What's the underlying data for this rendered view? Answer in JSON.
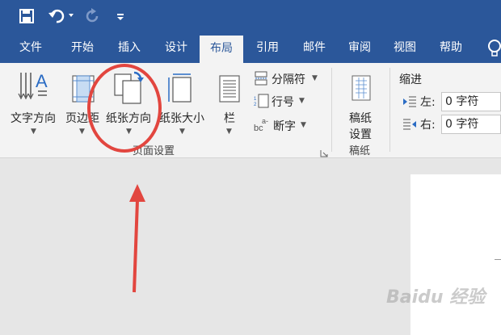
{
  "tabs": [
    "文件",
    "开始",
    "插入",
    "设计",
    "布局",
    "引用",
    "邮件",
    "审阅",
    "视图",
    "帮助"
  ],
  "ribbon": {
    "text_direction": "文字方向",
    "margins": "页边距",
    "orientation": "纸张方向",
    "size": "纸张大小",
    "columns": "栏",
    "breaks": "分隔符",
    "line_numbers": "行号",
    "hyphenation": "断字",
    "page_setup_group": "页面设置",
    "manuscript_line1": "稿纸",
    "manuscript_line2": "设置",
    "manuscript_group": "稿纸",
    "indent_title": "缩进",
    "indent_left_label": "左:",
    "indent_left_value": "0 字符",
    "indent_right_label": "右:",
    "indent_right_value": "0 字符"
  },
  "watermark": "Baidu 经验",
  "colors": {
    "ribbon_blue": "#2b579a",
    "annotation_red": "#e2463f"
  }
}
